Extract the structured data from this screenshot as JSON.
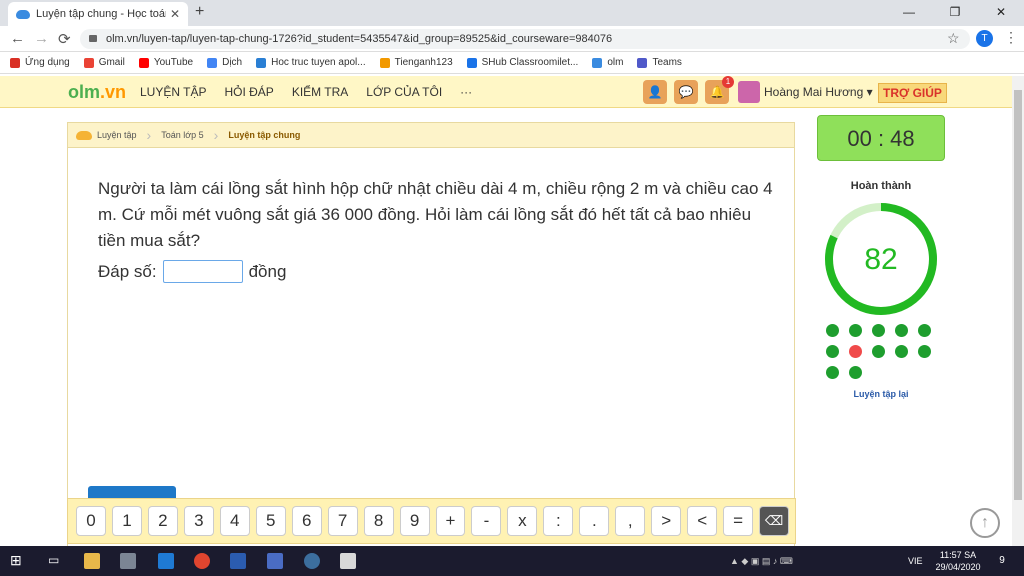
{
  "browser": {
    "tab_title": "Luyện tập chung - Học toán với O",
    "new_tab": "+",
    "url": "olm.vn/luyen-tap/luyen-tap-chung-1726?id_student=5435547&id_group=89525&id_courseware=984076",
    "profile_initial": "T",
    "window_controls": [
      "—",
      "❐",
      "✕"
    ]
  },
  "bookmarks": [
    {
      "label": "Ứng dụng",
      "color": "#d93025"
    },
    {
      "label": "Gmail",
      "color": "#ea4335"
    },
    {
      "label": "YouTube",
      "color": "#ff0000"
    },
    {
      "label": "Dịch",
      "color": "#4285f4"
    },
    {
      "label": "Hoc truc tuyen apol...",
      "color": "#2a7fd4"
    },
    {
      "label": "Tienganh123",
      "color": "#f29900"
    },
    {
      "label": "SHub Classroomilet...",
      "color": "#1a73e8"
    },
    {
      "label": "olm",
      "color": "#3a8be0"
    },
    {
      "label": "Teams",
      "color": "#5059c9"
    }
  ],
  "site": {
    "logo_a": "olm",
    "logo_b": ".vn",
    "nav": [
      "LUYỆN TẬP",
      "HỎI ĐÁP",
      "KIỂM TRA",
      "LỚP CỦA TÔI",
      "···"
    ],
    "notification_count": "1",
    "user_name": "Hoàng Mai Hương ▾",
    "help": "TRỢ GIÚP"
  },
  "breadcrumb": [
    "Luyện tập",
    "Toán lớp 5",
    "Luyện tập chung"
  ],
  "question": {
    "text": "Người ta làm cái lồng sắt hình hộp chữ nhật chiều dài 4 m, chiều rộng 2 m và chiều cao 4 m. Cứ mỗi mét vuông sắt giá 36 000 đồng. Hỏi làm cái lồng sắt đó hết tất cả bao nhiêu tiền mua sắt?",
    "answer_label": "Đáp số:",
    "answer_value": "",
    "answer_unit": "đồng"
  },
  "keypad": [
    "0",
    "1",
    "2",
    "3",
    "4",
    "5",
    "6",
    "7",
    "8",
    "9",
    "+",
    "-",
    "x",
    ":",
    ".",
    ",",
    ">",
    "<",
    "=",
    "⌫"
  ],
  "progress": {
    "timer": "00 : 48",
    "done_label": "Hoàn thành",
    "score": "82",
    "score_fraction": 0.82,
    "ring_color": "#22b922",
    "ring_track_color": "#d3f0c8",
    "results": [
      "correct",
      "correct",
      "correct",
      "correct",
      "correct",
      "correct",
      "wrong",
      "correct",
      "correct",
      "correct",
      "correct",
      "correct"
    ],
    "correct_color": "#1e9e2e",
    "wrong_color": "#f04a4a",
    "retry_label": "Luyện tập lại"
  },
  "taskbar": {
    "language": "VIE",
    "time": "11:57 SA",
    "date": "29/04/2020",
    "notifications": "9"
  }
}
